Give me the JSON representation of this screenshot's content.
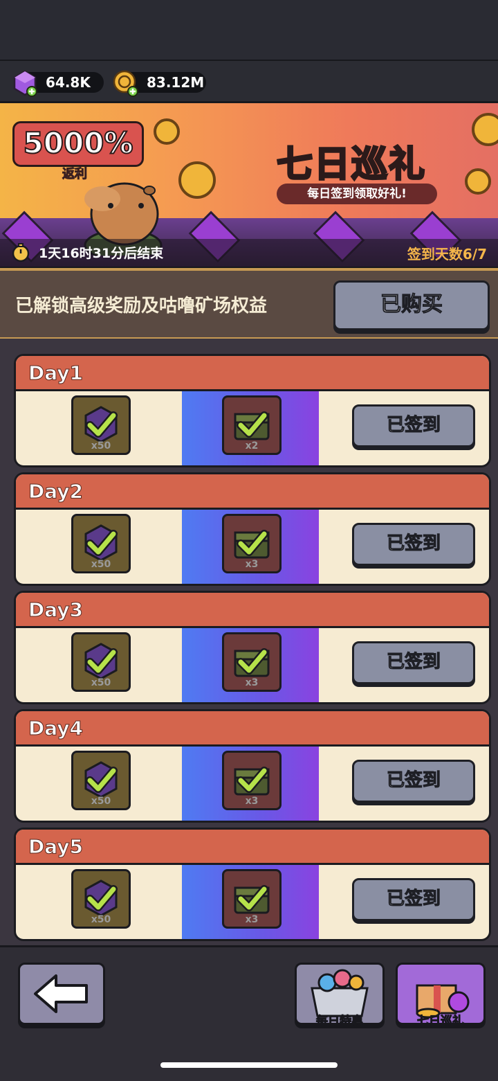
{
  "currency": {
    "gems": "64.8K",
    "coins": "83.12M"
  },
  "banner": {
    "bonus": "5000%",
    "bonus_sub": "返利",
    "title": "七日巡礼",
    "subtitle": "每日签到领取好礼!",
    "timer": "1天16时31分后结束",
    "signin_days": "签到天数6/7"
  },
  "unlock": {
    "text": "已解锁高级奖励及咕噜矿场权益",
    "button": "已购买"
  },
  "days": [
    {
      "label": "Day1",
      "free_qty": "x50",
      "premium_qty": "x2",
      "button": "已签到"
    },
    {
      "label": "Day2",
      "free_qty": "x50",
      "premium_qty": "x3",
      "button": "已签到"
    },
    {
      "label": "Day3",
      "free_qty": "x50",
      "premium_qty": "x3",
      "button": "已签到"
    },
    {
      "label": "Day4",
      "free_qty": "x50",
      "premium_qty": "x3",
      "button": "已签到"
    },
    {
      "label": "Day5",
      "free_qty": "x50",
      "premium_qty": "x3",
      "button": "已签到"
    }
  ],
  "nav": {
    "daily_deal": "每日特惠",
    "seven_day": "七日巡礼"
  },
  "colors": {
    "header_red": "#d4654d",
    "card_cream": "#f6ebd2",
    "button_gray": "#8a8fa3",
    "check_green": "#b6e24a"
  }
}
